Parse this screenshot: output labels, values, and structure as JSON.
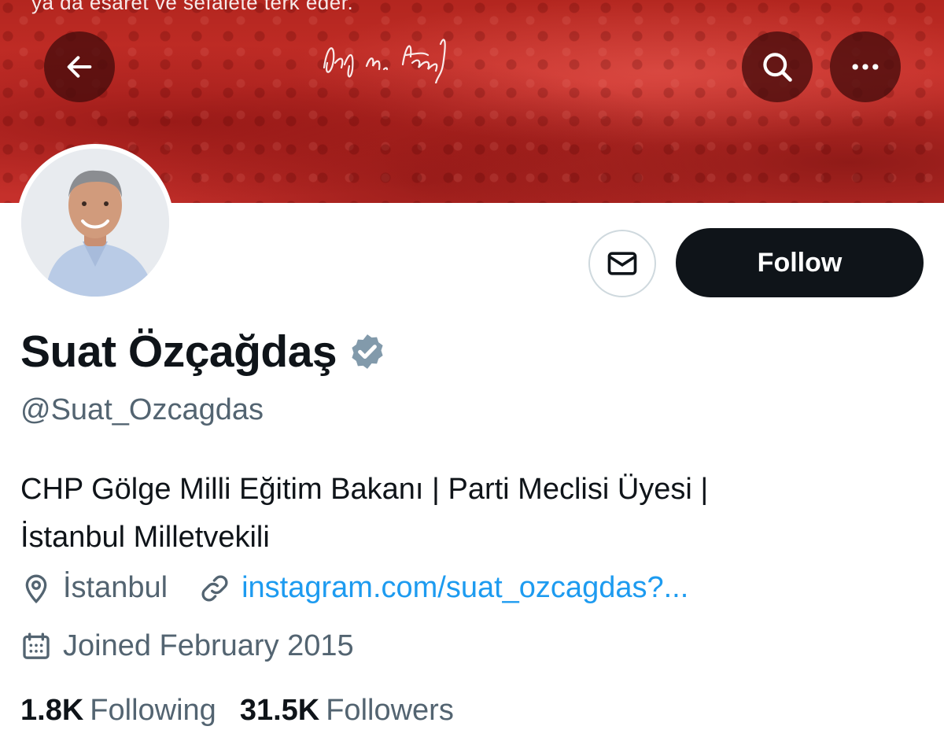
{
  "banner": {
    "quote": "ya da esaret ve sefalete terk eder.",
    "signature_text": "Gazi M. Kemal"
  },
  "nav": {
    "back_icon": "arrow-left-icon",
    "search_icon": "search-icon",
    "more_icon": "more-horizontal-icon"
  },
  "profile": {
    "display_name": "Suat Özçağdaş",
    "handle": "@Suat_Ozcagdas",
    "verified_icon": "verified-badge-icon",
    "verified_color": "#829aab",
    "bio_lines": [
      "CHP Gölge Milli Eğitim Bakanı | Parti Meclisi Üyesi |",
      "İstanbul Milletvekili"
    ],
    "location": "İstanbul",
    "website": "instagram.com/suat_ozcagdas?...",
    "joined": "Joined February 2015"
  },
  "actions": {
    "message_icon": "envelope-icon",
    "follow_label": "Follow"
  },
  "stats": {
    "following_count": "1.8K",
    "following_label": "Following",
    "followers_count": "31.5K",
    "followers_label": "Followers"
  },
  "colors": {
    "banner_red": "#c5302b",
    "link_blue": "#1d9bf0",
    "secondary_text": "#536471",
    "primary_text": "#0f1419"
  }
}
